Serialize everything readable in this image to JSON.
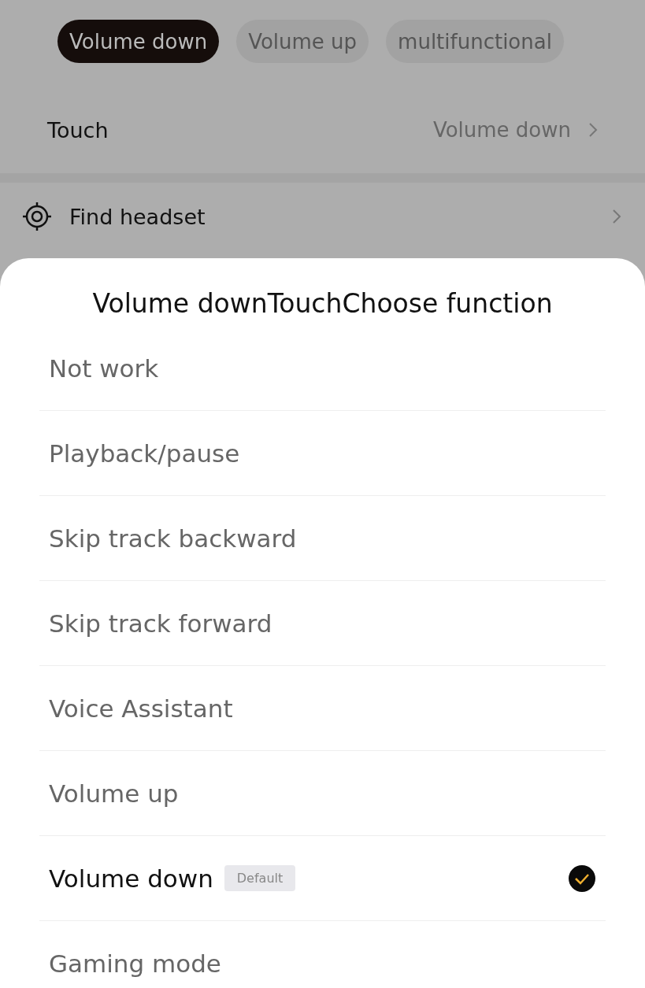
{
  "tabs": [
    {
      "label": "Volume down",
      "selected": true
    },
    {
      "label": "Volume up",
      "selected": false
    },
    {
      "label": "multifunctional",
      "selected": false
    }
  ],
  "touch_row": {
    "label": "Touch",
    "value": "Volume down"
  },
  "find_row": {
    "label": "Find headset"
  },
  "sheet": {
    "title": "Volume downTouchChoose function",
    "options": [
      {
        "label": "Not work",
        "selected": false
      },
      {
        "label": "Playback/pause",
        "selected": false
      },
      {
        "label": "Skip track backward",
        "selected": false
      },
      {
        "label": "Skip track forward",
        "selected": false
      },
      {
        "label": "Voice Assistant",
        "selected": false
      },
      {
        "label": "Volume up",
        "selected": false
      },
      {
        "label": "Volume down",
        "badge": "Default",
        "selected": true
      },
      {
        "label": "Gaming mode",
        "selected": false
      }
    ]
  }
}
